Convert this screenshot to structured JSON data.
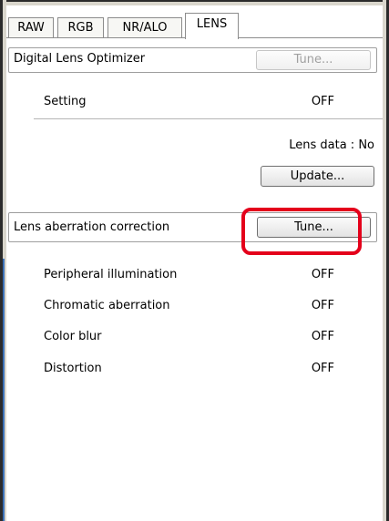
{
  "tabs": [
    "RAW",
    "RGB",
    "NR/ALO",
    "LENS"
  ],
  "active_tab": "LENS",
  "dlo": {
    "title": "Digital Lens Optimizer",
    "tune_label": "Tune...",
    "setting_label": "Setting",
    "setting_value": "OFF",
    "lens_data": "Lens data : No",
    "update_label": "Update..."
  },
  "lac": {
    "title": "Lens aberration correction",
    "tune_label": "Tune...",
    "rows": [
      {
        "label": "Peripheral illumination",
        "value": "OFF"
      },
      {
        "label": "Chromatic aberration",
        "value": "OFF"
      },
      {
        "label": "Color blur",
        "value": "OFF"
      },
      {
        "label": "Distortion",
        "value": "OFF"
      }
    ]
  },
  "colors": {
    "highlight": "#e4001b",
    "accent": "#3a6fb5"
  }
}
